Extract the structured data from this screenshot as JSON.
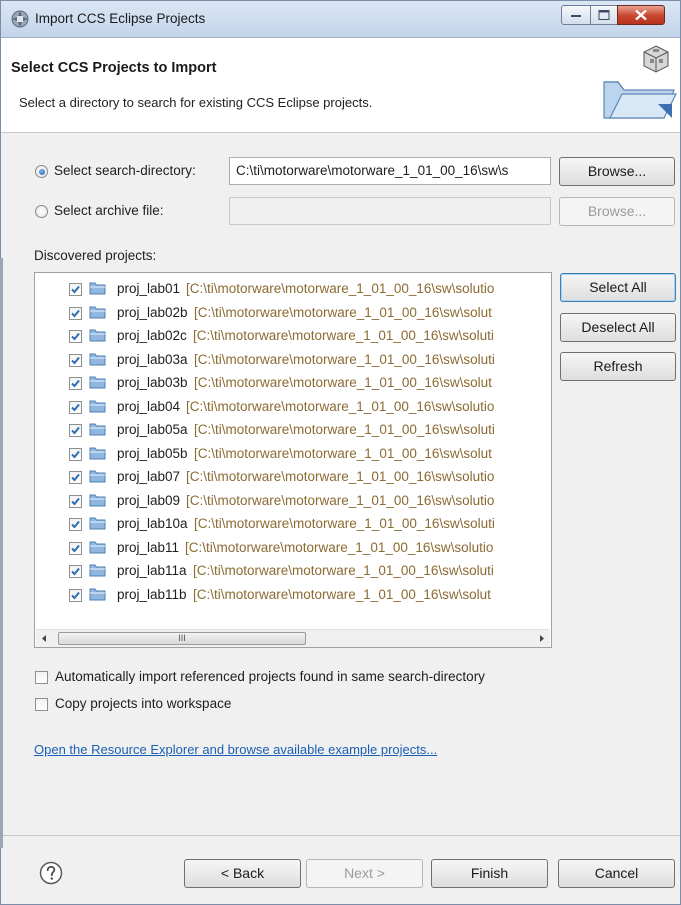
{
  "window": {
    "title": "Import CCS Eclipse Projects",
    "controls": {
      "minimize_icon": "minimize-icon",
      "maximize_icon": "maximize-icon",
      "close_icon": "close-icon"
    }
  },
  "header": {
    "title": "Select CCS Projects to Import",
    "subtitle": "Select a directory to search for existing CCS Eclipse projects."
  },
  "source": {
    "search_directory_label": "Select search-directory:",
    "search_directory_value": "C:\\ti\\motorware\\motorware_1_01_00_16\\sw\\s",
    "search_directory_selected": true,
    "browse_label": "Browse...",
    "archive_label": "Select archive file:",
    "archive_value": "",
    "archive_browse_label": "Browse..."
  },
  "projects": {
    "label": "Discovered projects:",
    "items": [
      {
        "name": "proj_lab01",
        "path": "[C:\\ti\\motorware\\motorware_1_01_00_16\\sw\\solutio",
        "checked": true
      },
      {
        "name": "proj_lab02b",
        "path": "[C:\\ti\\motorware\\motorware_1_01_00_16\\sw\\solut",
        "checked": true
      },
      {
        "name": "proj_lab02c",
        "path": "[C:\\ti\\motorware\\motorware_1_01_00_16\\sw\\soluti",
        "checked": true
      },
      {
        "name": "proj_lab03a",
        "path": "[C:\\ti\\motorware\\motorware_1_01_00_16\\sw\\soluti",
        "checked": true
      },
      {
        "name": "proj_lab03b",
        "path": "[C:\\ti\\motorware\\motorware_1_01_00_16\\sw\\solut",
        "checked": true
      },
      {
        "name": "proj_lab04",
        "path": "[C:\\ti\\motorware\\motorware_1_01_00_16\\sw\\solutio",
        "checked": true
      },
      {
        "name": "proj_lab05a",
        "path": "[C:\\ti\\motorware\\motorware_1_01_00_16\\sw\\soluti",
        "checked": true
      },
      {
        "name": "proj_lab05b",
        "path": "[C:\\ti\\motorware\\motorware_1_01_00_16\\sw\\solut",
        "checked": true
      },
      {
        "name": "proj_lab07",
        "path": "[C:\\ti\\motorware\\motorware_1_01_00_16\\sw\\solutio",
        "checked": true
      },
      {
        "name": "proj_lab09",
        "path": "[C:\\ti\\motorware\\motorware_1_01_00_16\\sw\\solutio",
        "checked": true
      },
      {
        "name": "proj_lab10a",
        "path": "[C:\\ti\\motorware\\motorware_1_01_00_16\\sw\\soluti",
        "checked": true
      },
      {
        "name": "proj_lab11",
        "path": "[C:\\ti\\motorware\\motorware_1_01_00_16\\sw\\solutio",
        "checked": true
      },
      {
        "name": "proj_lab11a",
        "path": "[C:\\ti\\motorware\\motorware_1_01_00_16\\sw\\soluti",
        "checked": true
      },
      {
        "name": "proj_lab11b",
        "path": "[C:\\ti\\motorware\\motorware_1_01_00_16\\sw\\solut",
        "checked": true
      }
    ],
    "select_all_label": "Select All",
    "deselect_all_label": "Deselect All",
    "refresh_label": "Refresh",
    "scroll_thumb_grip": "III"
  },
  "options": {
    "auto_import_label": "Automatically import referenced projects found in same search-directory",
    "auto_import_checked": false,
    "copy_label": "Copy projects into workspace",
    "copy_checked": false
  },
  "link": {
    "text": "Open the Resource Explorer and browse available example projects..."
  },
  "footer": {
    "help_icon": "help-icon",
    "back_label": "< Back",
    "next_label": "Next >",
    "finish_label": "Finish",
    "cancel_label": "Cancel"
  },
  "colors": {
    "path_text": "#8b6b33",
    "link": "#1a5fb4",
    "checkbox_check": "#2d6fb0",
    "folder": "#8fb7e0"
  }
}
